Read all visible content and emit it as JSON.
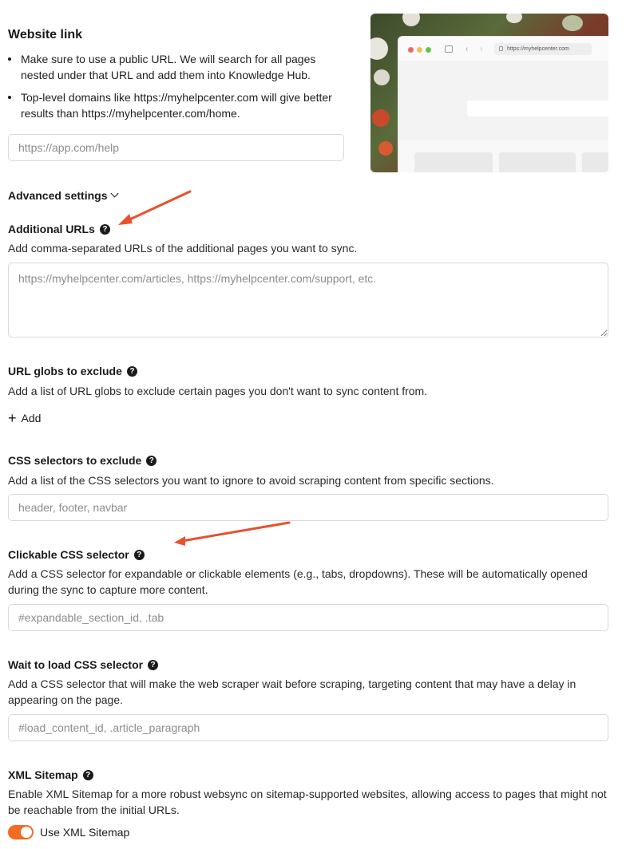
{
  "website_link": {
    "title": "Website link",
    "bullets": [
      "Make sure to use a public URL. We will search for all pages nested under that URL and add them into Knowledge Hub.",
      "Top-level domains like https://myhelpcenter.com will give better results than https://myhelpcenter.com/home."
    ],
    "input_placeholder": "https://app.com/help",
    "input_value": ""
  },
  "preview": {
    "url": "https://myhelpcenter.com"
  },
  "advanced": {
    "label": "Advanced settings"
  },
  "additional_urls": {
    "label": "Additional URLs",
    "description": "Add comma-separated URLs of the additional pages you want to sync.",
    "placeholder": "https://myhelpcenter.com/articles, https://myhelpcenter.com/support, etc."
  },
  "url_globs": {
    "label": "URL globs to exclude",
    "description": "Add a list of URL globs to exclude certain pages you don't want to sync content from.",
    "add_label": "Add"
  },
  "css_exclude": {
    "label": "CSS selectors to exclude",
    "description": "Add a list of the CSS selectors you want to ignore to avoid scraping content from specific sections.",
    "placeholder": "header, footer, navbar"
  },
  "clickable": {
    "label": "Clickable CSS selector",
    "description": "Add a CSS selector for expandable or clickable elements (e.g., tabs, dropdowns). These will be automatically opened during the sync to capture more content.",
    "placeholder": "#expandable_section_id, .tab"
  },
  "wait_load": {
    "label": "Wait to load CSS selector",
    "description": "Add a CSS selector that will make the web scraper wait before scraping, targeting content that may have a delay in appearing on the page.",
    "placeholder": "#load_content_id, .article_paragraph"
  },
  "xml_sitemap": {
    "label": "XML Sitemap",
    "description": "Enable XML Sitemap for a more robust websync on sitemap-supported websites, allowing access to pages that might not be reachable from the initial URLs.",
    "toggle_label": "Use XML Sitemap",
    "toggle_on": true
  },
  "icons": {
    "help": "question-circle-icon",
    "chevron": "chevron-down-icon",
    "plus": "plus-icon",
    "annotation_arrow": "arrow-icon"
  },
  "colors": {
    "accent": "#f26b21",
    "annotation": "#e8502e"
  }
}
